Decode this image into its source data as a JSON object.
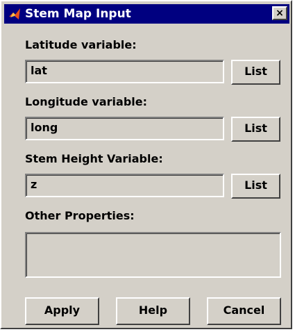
{
  "window": {
    "title": "Stem Map Input",
    "close_label": "×"
  },
  "fields": [
    {
      "label": "Latitude variable:",
      "value": "lat",
      "list_label": "List"
    },
    {
      "label": "Longitude variable:",
      "value": "long",
      "list_label": "List"
    },
    {
      "label": "Stem Height Variable:",
      "value": "z",
      "list_label": "List"
    }
  ],
  "other": {
    "label": "Other Properties:",
    "value": ""
  },
  "buttons": {
    "apply": "Apply",
    "help": "Help",
    "cancel": "Cancel"
  },
  "colors": {
    "titlebar": "#000080",
    "face": "#d4d0c8",
    "icon_accent": "#e8501c"
  }
}
